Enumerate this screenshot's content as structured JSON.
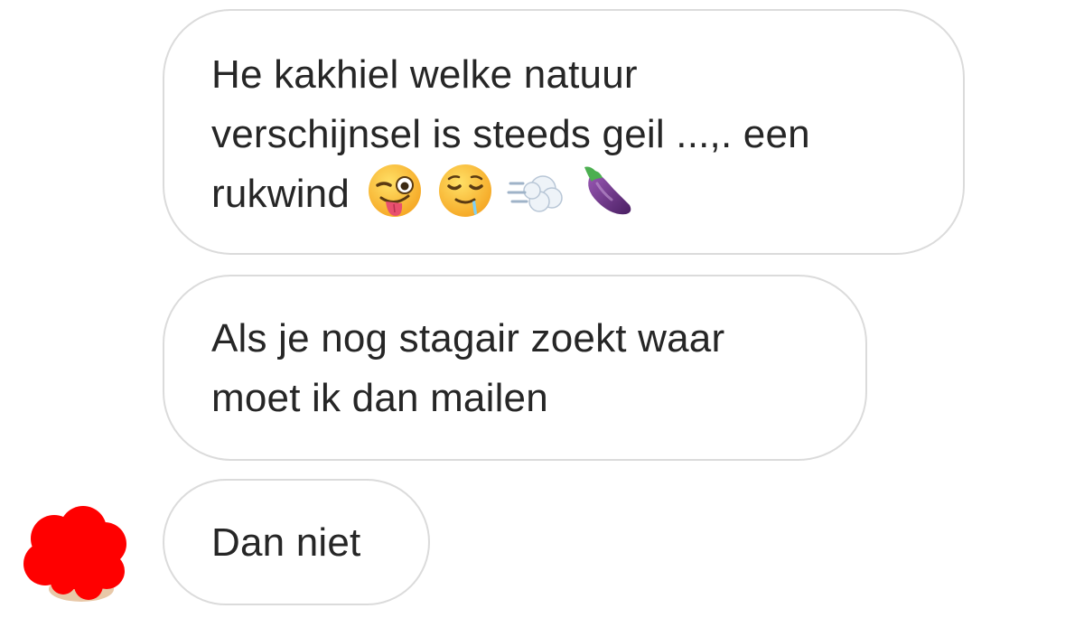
{
  "messages": [
    {
      "lines": [
        "He kakhiel welke natuur",
        "verschijnsel is steeds geil ...,. een",
        "rukwind"
      ],
      "emojis": [
        "winking-face-with-tongue-emoji",
        "drooling-face-emoji",
        "dash-symbol-emoji",
        "eggplant-emoji"
      ]
    },
    {
      "lines": [
        "Als je nog stagair zoekt waar",
        "moet ik dan mailen"
      ]
    },
    {
      "lines": [
        "Dan niet"
      ]
    }
  ],
  "avatar": {
    "icon": "redacted-avatar",
    "redaction_color": "#ff0000"
  },
  "colors": {
    "bubble_border": "#dbdbdb",
    "text": "#262626",
    "background": "#ffffff"
  }
}
